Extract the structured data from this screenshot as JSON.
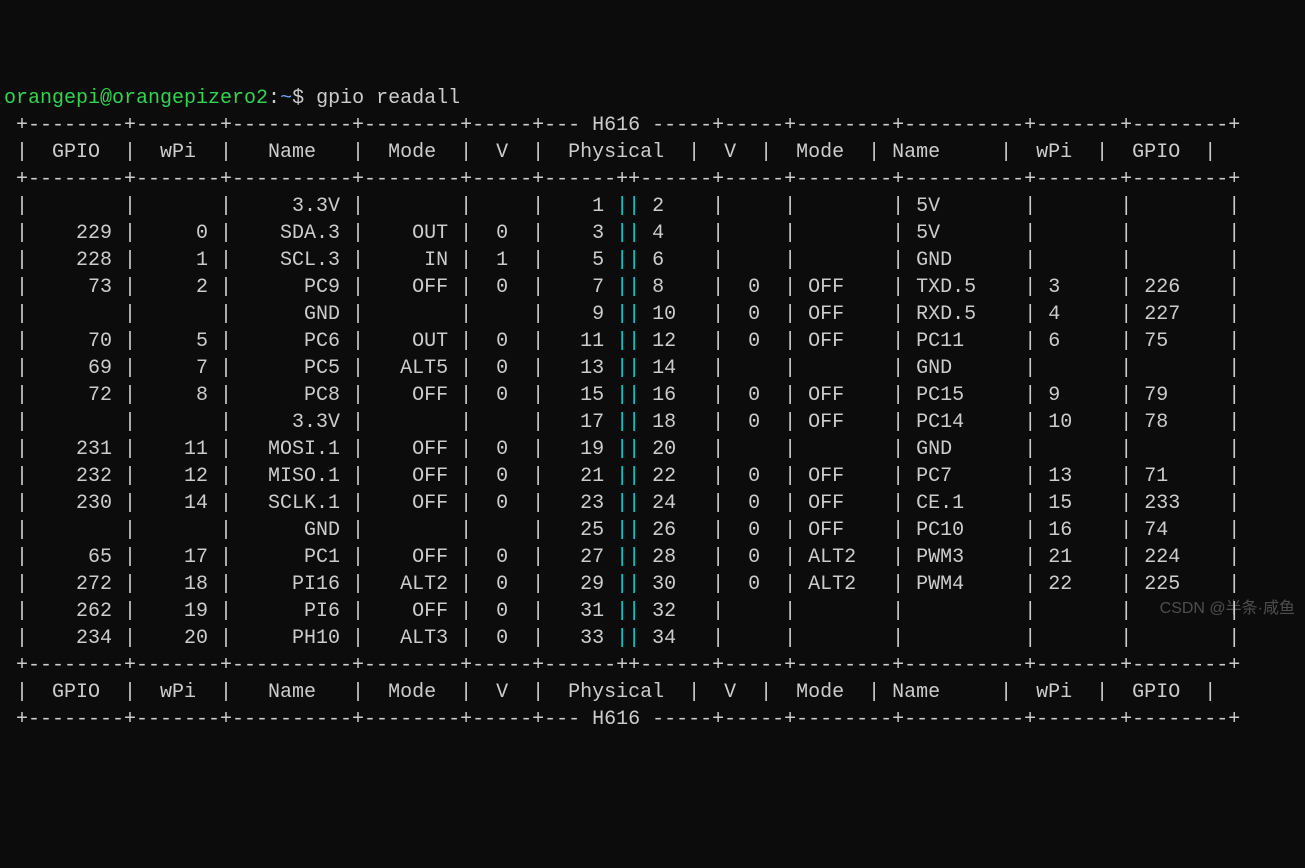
{
  "prompt": {
    "user": "orangepi",
    "host": "orangepizero2",
    "path": "~",
    "symbol": "$",
    "command": "gpio readall"
  },
  "table": {
    "chip": "H616",
    "headers": [
      "GPIO",
      "wPi",
      "Name",
      "Mode",
      "V",
      "Physical",
      "V",
      "Mode",
      "Name",
      "wPi",
      "GPIO"
    ],
    "rows": [
      {
        "l": {
          "gpio": "",
          "wpi": "",
          "name": "3.3V",
          "mode": "",
          "v": ""
        },
        "phys": [
          "1",
          "2"
        ],
        "r": {
          "v": "",
          "mode": "",
          "name": "5V",
          "wpi": "",
          "gpio": ""
        }
      },
      {
        "l": {
          "gpio": "229",
          "wpi": "0",
          "name": "SDA.3",
          "mode": "OUT",
          "v": "0"
        },
        "phys": [
          "3",
          "4"
        ],
        "r": {
          "v": "",
          "mode": "",
          "name": "5V",
          "wpi": "",
          "gpio": ""
        }
      },
      {
        "l": {
          "gpio": "228",
          "wpi": "1",
          "name": "SCL.3",
          "mode": "IN",
          "v": "1"
        },
        "phys": [
          "5",
          "6"
        ],
        "r": {
          "v": "",
          "mode": "",
          "name": "GND",
          "wpi": "",
          "gpio": ""
        }
      },
      {
        "l": {
          "gpio": "73",
          "wpi": "2",
          "name": "PC9",
          "mode": "OFF",
          "v": "0"
        },
        "phys": [
          "7",
          "8"
        ],
        "r": {
          "v": "0",
          "mode": "OFF",
          "name": "TXD.5",
          "wpi": "3",
          "gpio": "226"
        }
      },
      {
        "l": {
          "gpio": "",
          "wpi": "",
          "name": "GND",
          "mode": "",
          "v": ""
        },
        "phys": [
          "9",
          "10"
        ],
        "r": {
          "v": "0",
          "mode": "OFF",
          "name": "RXD.5",
          "wpi": "4",
          "gpio": "227"
        }
      },
      {
        "l": {
          "gpio": "70",
          "wpi": "5",
          "name": "PC6",
          "mode": "OUT",
          "v": "0"
        },
        "phys": [
          "11",
          "12"
        ],
        "r": {
          "v": "0",
          "mode": "OFF",
          "name": "PC11",
          "wpi": "6",
          "gpio": "75"
        }
      },
      {
        "l": {
          "gpio": "69",
          "wpi": "7",
          "name": "PC5",
          "mode": "ALT5",
          "v": "0"
        },
        "phys": [
          "13",
          "14"
        ],
        "r": {
          "v": "",
          "mode": "",
          "name": "GND",
          "wpi": "",
          "gpio": ""
        }
      },
      {
        "l": {
          "gpio": "72",
          "wpi": "8",
          "name": "PC8",
          "mode": "OFF",
          "v": "0"
        },
        "phys": [
          "15",
          "16"
        ],
        "r": {
          "v": "0",
          "mode": "OFF",
          "name": "PC15",
          "wpi": "9",
          "gpio": "79"
        }
      },
      {
        "l": {
          "gpio": "",
          "wpi": "",
          "name": "3.3V",
          "mode": "",
          "v": ""
        },
        "phys": [
          "17",
          "18"
        ],
        "r": {
          "v": "0",
          "mode": "OFF",
          "name": "PC14",
          "wpi": "10",
          "gpio": "78"
        }
      },
      {
        "l": {
          "gpio": "231",
          "wpi": "11",
          "name": "MOSI.1",
          "mode": "OFF",
          "v": "0"
        },
        "phys": [
          "19",
          "20"
        ],
        "r": {
          "v": "",
          "mode": "",
          "name": "GND",
          "wpi": "",
          "gpio": ""
        }
      },
      {
        "l": {
          "gpio": "232",
          "wpi": "12",
          "name": "MISO.1",
          "mode": "OFF",
          "v": "0"
        },
        "phys": [
          "21",
          "22"
        ],
        "r": {
          "v": "0",
          "mode": "OFF",
          "name": "PC7",
          "wpi": "13",
          "gpio": "71"
        }
      },
      {
        "l": {
          "gpio": "230",
          "wpi": "14",
          "name": "SCLK.1",
          "mode": "OFF",
          "v": "0"
        },
        "phys": [
          "23",
          "24"
        ],
        "r": {
          "v": "0",
          "mode": "OFF",
          "name": "CE.1",
          "wpi": "15",
          "gpio": "233"
        }
      },
      {
        "l": {
          "gpio": "",
          "wpi": "",
          "name": "GND",
          "mode": "",
          "v": ""
        },
        "phys": [
          "25",
          "26"
        ],
        "r": {
          "v": "0",
          "mode": "OFF",
          "name": "PC10",
          "wpi": "16",
          "gpio": "74"
        }
      },
      {
        "l": {
          "gpio": "65",
          "wpi": "17",
          "name": "PC1",
          "mode": "OFF",
          "v": "0"
        },
        "phys": [
          "27",
          "28"
        ],
        "r": {
          "v": "0",
          "mode": "ALT2",
          "name": "PWM3",
          "wpi": "21",
          "gpio": "224"
        }
      },
      {
        "l": {
          "gpio": "272",
          "wpi": "18",
          "name": "PI16",
          "mode": "ALT2",
          "v": "0"
        },
        "phys": [
          "29",
          "30"
        ],
        "r": {
          "v": "0",
          "mode": "ALT2",
          "name": "PWM4",
          "wpi": "22",
          "gpio": "225"
        }
      },
      {
        "l": {
          "gpio": "262",
          "wpi": "19",
          "name": "PI6",
          "mode": "OFF",
          "v": "0"
        },
        "phys": [
          "31",
          "32"
        ],
        "r": {
          "v": "",
          "mode": "",
          "name": "",
          "wpi": "",
          "gpio": ""
        }
      },
      {
        "l": {
          "gpio": "234",
          "wpi": "20",
          "name": "PH10",
          "mode": "ALT3",
          "v": "0"
        },
        "phys": [
          "33",
          "34"
        ],
        "r": {
          "v": "",
          "mode": "",
          "name": "",
          "wpi": "",
          "gpio": ""
        }
      }
    ]
  },
  "watermark": "CSDN @半条·咸鱼"
}
